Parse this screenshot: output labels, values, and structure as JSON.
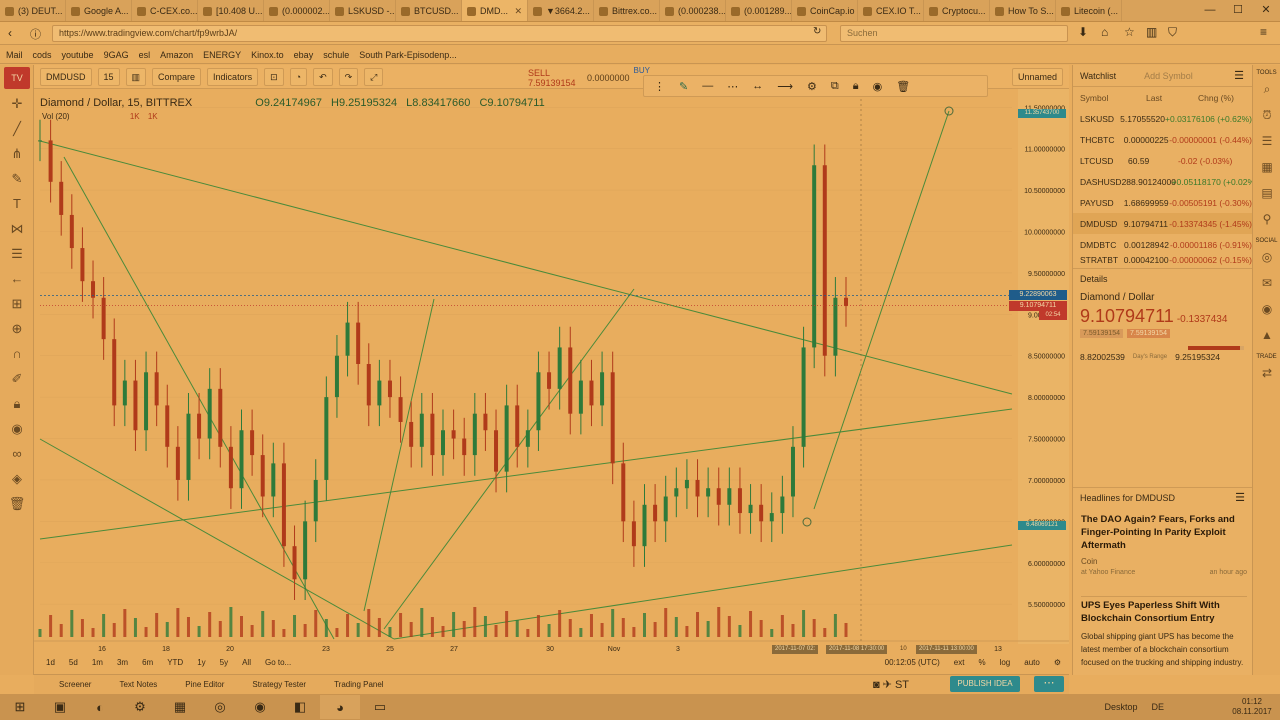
{
  "browser": {
    "tabs": [
      {
        "label": "(3) DEUT..."
      },
      {
        "label": "Google A..."
      },
      {
        "label": "C-CEX.co..."
      },
      {
        "label": "[10.408 U..."
      },
      {
        "label": "(0.000002..."
      },
      {
        "label": "LSKUSD -..."
      },
      {
        "label": "BTCUSD..."
      },
      {
        "label": "DMD..."
      },
      {
        "label": "▼3664.2..."
      },
      {
        "label": "Bittrex.co..."
      },
      {
        "label": "(0.000238..."
      },
      {
        "label": "(0.001289..."
      },
      {
        "label": "CoinCap.io"
      },
      {
        "label": "CEX.IO T..."
      },
      {
        "label": "Cryptocu..."
      },
      {
        "label": "How To S..."
      },
      {
        "label": "Litecoin (..."
      }
    ],
    "url": "https://www.tradingview.com/chart/fp9wrbJA/",
    "search_placeholder": "Suchen",
    "bookmarks": [
      "Mail",
      "cods",
      "youtube",
      "9GAG",
      "esl",
      "Amazon",
      "ENERGY",
      "Kinox.to",
      "ebay",
      "schule",
      "South Park-Episodenp..."
    ]
  },
  "toolbar": {
    "symbol": "DMDUSD",
    "interval": "15",
    "compare": "Compare",
    "indicators": "Indicators",
    "sell_label": "SELL",
    "sell_value": "7.59139154",
    "buy_label": "BUY",
    "mid_value": "0.0000000",
    "layout_name": "Unnamed"
  },
  "legend": {
    "title": "Diamond / Dollar, 15, BITTREX",
    "open": "O9.24174967",
    "high": "H9.25195324",
    "low": "L8.83417660",
    "close": "C9.10794711",
    "vol": "Vol (20)",
    "vol_values": "1K",
    "vol_values2": "1K"
  },
  "chart_data": {
    "type": "line",
    "title": "Diamond / Dollar, 15, BITTREX",
    "x_ticks": [
      "16",
      "18",
      "20",
      "23",
      "25",
      "27",
      "30",
      "Nov",
      "3",
      "13"
    ],
    "y_ticks": [
      "11.50000000",
      "11.00000000",
      "10.50000000",
      "10.00000000",
      "9.50000000",
      "9.00000000",
      "8.50000000",
      "8.00000000",
      "7.50000000",
      "7.00000000",
      "6.50000000",
      "6.00000000",
      "5.50000000"
    ],
    "ylim": [
      5.2,
      11.6
    ],
    "last_price": "9.10794711",
    "crosshair_price": "9.22890063",
    "countdown": "02:54",
    "high_label": "11.35743700",
    "low_label": "6.48069121",
    "time_labels": [
      "2017-11-07 02:",
      "2017-11-08 17:30:00",
      "10",
      "2017-11-11 13:00:00"
    ],
    "series": [
      {
        "values": [
          11.1,
          10.6,
          10.2,
          9.8,
          9.4,
          9.2,
          8.7,
          7.9,
          8.2,
          7.6,
          8.3,
          7.9,
          7.4,
          7.0,
          7.8,
          7.5,
          8.1,
          7.4,
          6.9,
          7.6,
          7.3,
          6.8,
          7.2,
          6.2,
          5.8,
          6.5,
          7.0,
          8.0,
          8.5,
          8.9,
          8.4,
          7.9,
          8.2,
          8.0,
          7.7,
          7.4,
          7.8,
          7.3,
          7.6,
          7.5,
          7.3,
          7.8,
          7.6,
          7.1,
          7.9,
          7.4,
          7.6,
          8.3,
          8.1,
          8.6,
          7.8,
          8.2,
          7.9,
          8.3,
          7.2,
          6.5,
          6.2,
          6.7,
          6.5,
          6.8,
          6.9,
          7.0,
          6.8,
          6.9,
          6.7,
          6.9,
          6.6,
          6.7,
          6.5,
          6.6,
          6.8,
          7.4,
          8.6,
          10.8,
          8.5,
          9.2,
          9.1
        ]
      }
    ]
  },
  "time_range": {
    "buttons": [
      "1d",
      "5d",
      "1m",
      "3m",
      "6m",
      "YTD",
      "1y",
      "5y",
      "All",
      "Go to..."
    ],
    "clock": "00:12:05 (UTC)",
    "ext": "ext",
    "pct": "%",
    "log": "log",
    "auto": "auto"
  },
  "bottom_panels": [
    "Screener",
    "Text Notes",
    "Pine Editor",
    "Strategy Tester",
    "Trading Panel"
  ],
  "publish": "PUBLISH IDEA",
  "watchlist": {
    "title": "Watchlist",
    "add_placeholder": "Add Symbol",
    "headers": {
      "symbol": "Symbol",
      "last": "Last",
      "change": "Chng (%)"
    },
    "rows": [
      {
        "symbol": "LSKUSD",
        "last": "5.17055520",
        "change": "+0.03176106 (+0.62%)",
        "positive": true
      },
      {
        "symbol": "THCBTC",
        "last": "0.00000225",
        "change": "-0.00000001 (-0.44%)",
        "positive": false
      },
      {
        "symbol": "LTCUSD",
        "last": "60.59",
        "change": "-0.02 (-0.03%)",
        "positive": false
      },
      {
        "symbol": "DASHUSD",
        "last": "288.90124000",
        "change": "+0.05118170 (+0.02%)",
        "positive": true
      },
      {
        "symbol": "PAYUSD",
        "last": "1.68699959",
        "change": "-0.00505191 (-0.30%)",
        "positive": false
      },
      {
        "symbol": "DMDUSD",
        "last": "9.10794711",
        "change": "-0.13374345 (-1.45%)",
        "positive": false
      },
      {
        "symbol": "DMDBTC",
        "last": "0.00128942",
        "change": "-0.00001186 (-0.91%)",
        "positive": false
      },
      {
        "symbol": "STRATBT",
        "last": "0.00042100",
        "change": "-0.00000062 (-0.15%)",
        "positive": false
      }
    ]
  },
  "details": {
    "title": "Details",
    "name": "Diamond / Dollar",
    "price": "9.10794711",
    "change": "-0.1337434",
    "bid": "7.59139154",
    "ask": "7.59139154",
    "range_low": "8.82002539",
    "range_label": "Day's Range",
    "range_high": "9.25195324",
    "range_level": 0.93
  },
  "headlines": {
    "title": "Headlines for DMDUSD",
    "items": [
      {
        "title": "The DAO Again? Fears, Forks and Finger-Pointing In Parity Exploit Aftermath",
        "source": "Coin",
        "meta": "at Yahoo Finance",
        "time": "an hour ago",
        "body": ""
      },
      {
        "title": "UPS Eyes Paperless Shift With Blockchain Consortium Entry",
        "source": "",
        "meta": "at Yahoo Finance",
        "time": "2 hours ago",
        "body": "Global shipping giant UPS has become the latest member of a blockchain consortium focused on the trucking and shipping industry."
      }
    ]
  },
  "right_strip": [
    "TOOLS",
    "SOCIAL",
    "TRADE"
  ],
  "taskbar": {
    "desktop": "Desktop",
    "lang": "DE",
    "time": "01:12",
    "date": "08.11.2017"
  }
}
